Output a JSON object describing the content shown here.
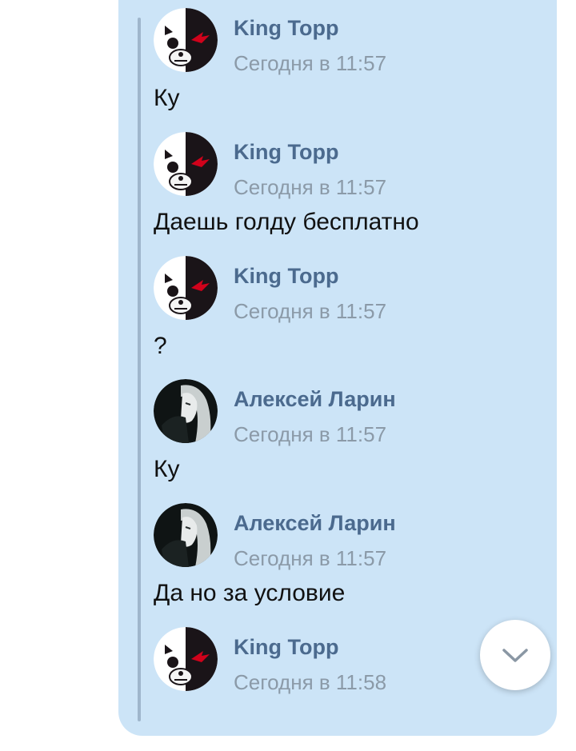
{
  "messages": [
    {
      "author": "King Topp",
      "time": "Сегодня в 11:57",
      "text": "Ку",
      "avatar": "monokuma-avatar"
    },
    {
      "author": "King Topp",
      "time": "Сегодня в 11:57",
      "text": "Даешь голду бесплатно",
      "avatar": "monokuma-avatar"
    },
    {
      "author": "King Topp",
      "time": "Сегодня в 11:57",
      "text": "?",
      "avatar": "monokuma-avatar"
    },
    {
      "author": "Алексей Ларин",
      "time": "Сегодня в 11:57",
      "text": "Ку",
      "avatar": "person-photo-avatar"
    },
    {
      "author": "Алексей Ларин",
      "time": "Сегодня в 11:57",
      "text": "Да но за условие",
      "avatar": "person-photo-avatar"
    },
    {
      "author": "King Topp",
      "time": "Сегодня в 11:58",
      "text": "",
      "avatar": "monokuma-avatar"
    }
  ],
  "scroll_button": {
    "icon": "chevron-down-icon"
  },
  "colors": {
    "bubble": "#cce4f7",
    "author": "#4b6a8e",
    "time": "#8b9aa8",
    "quote_bar": "#9fb6cc"
  }
}
